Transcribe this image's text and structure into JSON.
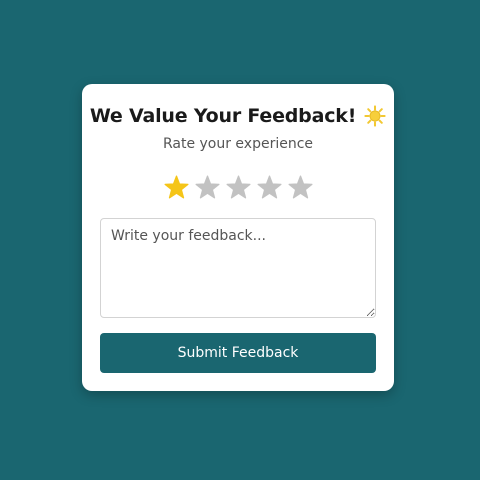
{
  "card": {
    "title": "We Value Your Feedback!",
    "title_icon": "sun-icon",
    "subtitle": "Rate your experience"
  },
  "rating": {
    "value": 1,
    "max": 5,
    "filled_color": "#f5c518",
    "empty_color": "#c2c2c2"
  },
  "feedback": {
    "placeholder": "Write your feedback...",
    "value": ""
  },
  "submit": {
    "label": "Submit Feedback"
  },
  "colors": {
    "background": "#1a6670",
    "accent": "#1a6670",
    "card": "#ffffff"
  }
}
